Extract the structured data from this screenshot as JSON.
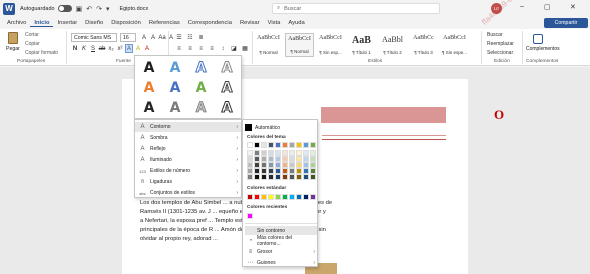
{
  "titlebar": {
    "logo": "W",
    "autosave_label": "Autoguardado",
    "doc_name": "Egipto.docx",
    "search_placeholder": "Buscar",
    "avatar_initials": "LE"
  },
  "menu": {
    "tabs": [
      "Archivo",
      "Inicio",
      "Insertar",
      "Diseño",
      "Disposición",
      "Referencias",
      "Correspondencia",
      "Revisar",
      "Vista",
      "Ayuda"
    ],
    "active_tab": "Inicio",
    "share_label": "Compartir"
  },
  "ribbon": {
    "clipboard": {
      "paste_label": "Pegar",
      "items": [
        "Cortar",
        "Copiar",
        "Copiar formato"
      ],
      "group_label": "Portapapeles"
    },
    "font": {
      "name": "Comic Sans MS",
      "size": "16",
      "row1": [
        "A",
        "A",
        "Aa",
        "A"
      ],
      "row2": [
        "N",
        "K",
        "S",
        "ab",
        "x₂",
        "x²"
      ],
      "row3": [
        "A",
        "A",
        "A"
      ],
      "group_label": "Fuente"
    },
    "styles": {
      "tiles": [
        {
          "sample": "AaBbCcI",
          "name": "¶ Normal"
        },
        {
          "sample": "AaBbCcI",
          "name": "¶ Normal"
        },
        {
          "sample": "AaBbCcI",
          "name": "¶ Sin esp..."
        },
        {
          "sample": "AaB",
          "name": "¶ Título 1"
        },
        {
          "sample": "AaBbl",
          "name": "¶ Título 2"
        },
        {
          "sample": "AaBbCc",
          "name": "¶ Título 3"
        },
        {
          "sample": "AaBbCcI",
          "name": "¶ Sin espe..."
        }
      ],
      "group_label": "Estilos"
    },
    "editing": {
      "items": [
        "Buscar",
        "Reemplazar",
        "Seleccionar"
      ],
      "group_label": "Edición"
    },
    "addins": {
      "label": "Complementos",
      "group_label": "Complementos"
    }
  },
  "gallery": {
    "letter": "A",
    "colors": [
      "#1f1f1f",
      "#5b9bd5",
      "#4472c4",
      "#e8e8e8",
      "#ed7d31",
      "#4472c4",
      "#70ad47",
      "#404040",
      "#808080",
      "#7a7a7a",
      "#bfbfbf",
      "#2f2f2f"
    ]
  },
  "effects_menu": {
    "items": [
      {
        "icon": "A",
        "label": "Contorno",
        "arrow": true,
        "selected": true
      },
      {
        "icon": "A",
        "label": "Sombra",
        "arrow": true
      },
      {
        "icon": "A",
        "label": "Reflejo",
        "arrow": true
      },
      {
        "icon": "A",
        "label": "Iluminado",
        "arrow": true
      },
      {
        "icon": "123",
        "label": "Estilos de número",
        "arrow": true
      },
      {
        "icon": "fi",
        "label": "Ligaduras",
        "arrow": true
      },
      {
        "icon": "abc",
        "label": "Conjuntos de estilos",
        "arrow": true
      }
    ]
  },
  "contour_submenu": {
    "automatic": "Automático",
    "theme_header": "Colores del tema",
    "theme_colors": [
      [
        "#ffffff",
        "#000000",
        "#e7e6e6",
        "#44546a",
        "#4472c4",
        "#ed7d31",
        "#a5a5a5",
        "#ffc000",
        "#5b9bd5",
        "#70ad47"
      ],
      [
        "#f2f2f2",
        "#7f7f7f",
        "#d0cece",
        "#d6dce5",
        "#d9e2f3",
        "#fbe5d6",
        "#ededed",
        "#fff2cc",
        "#deebf7",
        "#e2f0d9"
      ],
      [
        "#d9d9d9",
        "#595959",
        "#aeabab",
        "#adb9ca",
        "#b4c7e7",
        "#f8cbad",
        "#dbdbdb",
        "#ffe699",
        "#bdd7ee",
        "#c5e0b4"
      ],
      [
        "#bfbfbf",
        "#404040",
        "#757171",
        "#8497b0",
        "#8faadc",
        "#f4b183",
        "#c9c9c9",
        "#ffd966",
        "#9dc3e6",
        "#a9d18e"
      ],
      [
        "#a6a6a6",
        "#262626",
        "#3a3838",
        "#333f50",
        "#2f5597",
        "#c55a11",
        "#7b7b7b",
        "#bf9000",
        "#2e75b6",
        "#548235"
      ],
      [
        "#7f7f7f",
        "#0d0d0d",
        "#171616",
        "#222a35",
        "#203864",
        "#843c0c",
        "#525252",
        "#7f6000",
        "#1f4e79",
        "#385723"
      ]
    ],
    "standard_header": "Colores estándar",
    "standard_colors": [
      "#c00000",
      "#ff0000",
      "#ffc000",
      "#ffff00",
      "#92d050",
      "#00b050",
      "#00b0f0",
      "#0070c0",
      "#002060",
      "#7030a0"
    ],
    "recent_header": "Colores recientes",
    "recent_colors": [
      "#ff00ff"
    ],
    "items": [
      {
        "icon": "",
        "label": "Sin contorno",
        "selected": true
      },
      {
        "icon": "◔",
        "label": "Más colores del contorno..."
      },
      {
        "icon": "≡",
        "label": "Grosor",
        "arrow": true
      },
      {
        "icon": "⋯",
        "label": "Guiones",
        "arrow": true
      }
    ]
  },
  "document": {
    "heading_letter": "O",
    "paragraph": [
      "Los dos templos de Abu Simbel ... a nubia de arenisca bajo las órdenes de",
      "Ramsés II (1301-1235 av. J ... equeño está dedicado a la diosa Hathor y",
      "a Nefertari, la esposa pref ... Templo está dedicado a los tres dioses",
      "principales de la época de R ... Amón de Karnak y Ptah de Memphis, sin",
      "olvidar al propio rey, adorad ..."
    ]
  },
  "watermark": "ffa46359-ecdc-4761-a4d1"
}
